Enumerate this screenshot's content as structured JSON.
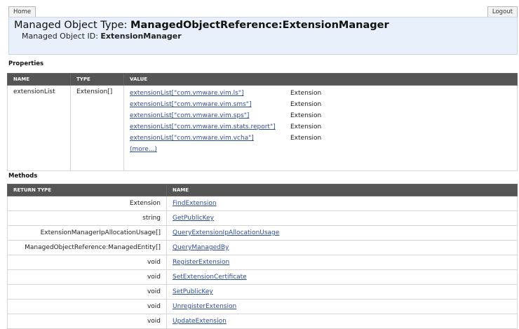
{
  "nav": {
    "home_label": "Home",
    "logout_label": "Logout"
  },
  "header": {
    "title_prefix": "Managed Object Type: ",
    "title_type": "ManagedObjectReference:ExtensionManager",
    "id_prefix": "Managed Object ID: ",
    "id_value": "ExtensionManager"
  },
  "properties": {
    "section_title": "Properties",
    "columns": [
      "NAME",
      "TYPE",
      "VALUE"
    ],
    "row": {
      "name": "extensionList",
      "type": "Extension[]",
      "values": [
        {
          "key": "extensionList[\"com.vmware.vim.ls\"]",
          "type": "Extension"
        },
        {
          "key": "extensionList[\"com.vmware.vim.sms\"]",
          "type": "Extension"
        },
        {
          "key": "extensionList[\"com.vmware.vim.sps\"]",
          "type": "Extension"
        },
        {
          "key": "extensionList[\"com.vmware.vim.stats.report\"]",
          "type": "Extension"
        },
        {
          "key": "extensionList[\"com.vmware.vim.vcha\"]",
          "type": "Extension"
        }
      ],
      "more_label": "(more...)"
    }
  },
  "methods": {
    "section_title": "Methods",
    "columns": [
      "RETURN TYPE",
      "NAME"
    ],
    "rows": [
      {
        "return_type": "Extension",
        "name": "FindExtension"
      },
      {
        "return_type": "string",
        "name": "GetPublicKey"
      },
      {
        "return_type": "ExtensionManagerIpAllocationUsage[]",
        "name": "QueryExtensionIpAllocationUsage"
      },
      {
        "return_type": "ManagedObjectReference:ManagedEntity[]",
        "name": "QueryManagedBy"
      },
      {
        "return_type": "void",
        "name": "RegisterExtension"
      },
      {
        "return_type": "void",
        "name": "SetExtensionCertificate"
      },
      {
        "return_type": "void",
        "name": "SetPublicKey"
      },
      {
        "return_type": "void",
        "name": "UnregisterExtension"
      },
      {
        "return_type": "void",
        "name": "UpdateExtension"
      }
    ]
  }
}
